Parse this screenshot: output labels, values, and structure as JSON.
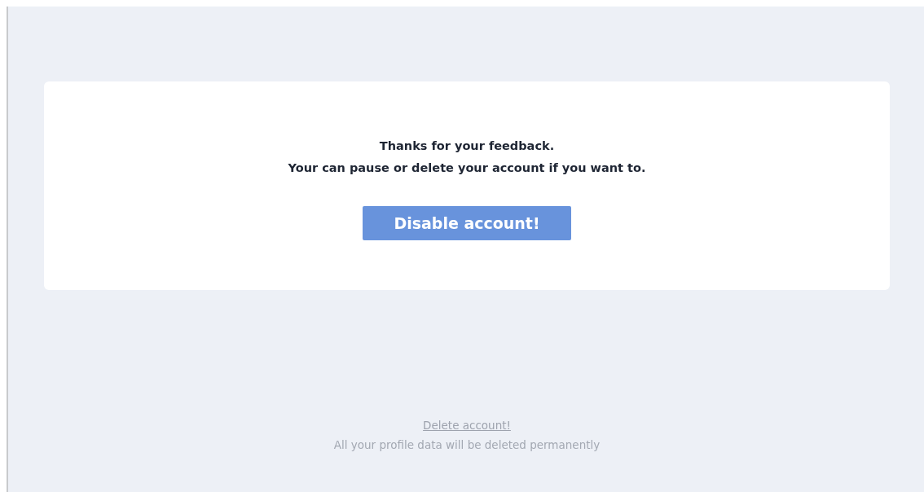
{
  "message": {
    "lines": [
      "Thanks for your feedback.",
      "Your can pause or delete your account if you want to."
    ]
  },
  "primary_button": {
    "label": "Disable account!"
  },
  "delete_link": {
    "label": "Delete account!"
  },
  "delete_note": "All your profile data will be deleted permanently"
}
